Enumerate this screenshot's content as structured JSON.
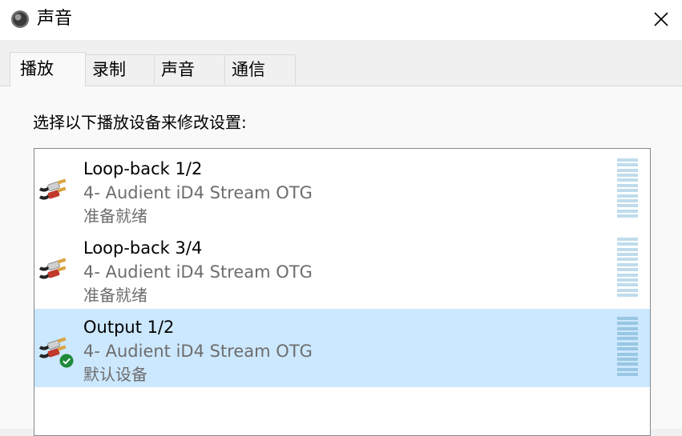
{
  "window": {
    "title": "声音",
    "icon": "speaker-icon"
  },
  "tabs": [
    {
      "label": "播放",
      "active": true
    },
    {
      "label": "录制",
      "active": false
    },
    {
      "label": "声音",
      "active": false
    },
    {
      "label": "通信",
      "active": false
    }
  ],
  "panel": {
    "instruction": "选择以下播放设备来修改设置:"
  },
  "devices": [
    {
      "name": "Loop-back 1/2",
      "subtitle": "4- Audient iD4 Stream OTG",
      "status": "准备就绪",
      "icon": "rca-cable-icon",
      "selected": false,
      "is_default": false
    },
    {
      "name": "Loop-back 3/4",
      "subtitle": "4- Audient iD4 Stream OTG",
      "status": "准备就绪",
      "icon": "rca-cable-icon",
      "selected": false,
      "is_default": false
    },
    {
      "name": "Output 1/2",
      "subtitle": "4- Audient iD4 Stream OTG",
      "status": "默认设备",
      "icon": "rca-cable-icon",
      "selected": true,
      "is_default": true
    }
  ],
  "colors": {
    "selection": "#cce8ff",
    "meter": "#bfdcec",
    "check": "#1e8a3a"
  }
}
